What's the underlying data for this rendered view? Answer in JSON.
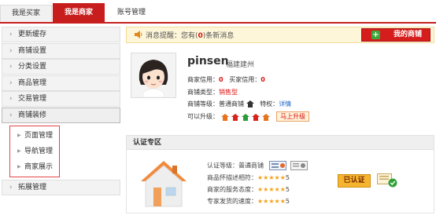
{
  "tabs": [
    {
      "label": "我是买家",
      "active": false
    },
    {
      "label": "我是商家",
      "active": true
    },
    {
      "label": "账号管理",
      "active": false
    }
  ],
  "sidebar": {
    "items": [
      {
        "label": "更新缓存"
      },
      {
        "label": "商铺设置"
      },
      {
        "label": "分类设置"
      },
      {
        "label": "商品管理"
      },
      {
        "label": "交易管理"
      },
      {
        "label": "商铺装修"
      }
    ],
    "submenu": [
      {
        "label": "页面管理"
      },
      {
        "label": "导航管理"
      },
      {
        "label": "商家展示"
      }
    ],
    "last_item": {
      "label": "拓展管理"
    }
  },
  "notice": {
    "prefix": "消息提醒：您有(",
    "count": "0",
    "suffix": ")条新消息"
  },
  "myshop_button": {
    "label": "我的商铺"
  },
  "profile": {
    "name": "pinsen",
    "location": "福建建州",
    "seller_credit_label": "商家信用：",
    "seller_credit": "0",
    "buyer_credit_label": "买家信用：",
    "buyer_credit": "0",
    "shop_type_label": "商铺类型：",
    "shop_type": "销售型",
    "shop_level_label": "商铺等级：",
    "shop_level": "普通商铺",
    "privilege_label": "特权：",
    "privilege_link": "详情",
    "upgrade_label": "可以升级：",
    "upgrade_button": "马上升级"
  },
  "cert": {
    "title": "认证专区",
    "level_label": "认证等级：",
    "level_value": "普通商铺",
    "rows": [
      {
        "label": "商品怀描述相符：",
        "stars": "★★★★★",
        "score": "5"
      },
      {
        "label": "商家的服务态度：",
        "stars": "★★★★★",
        "score": "5"
      },
      {
        "label": "专家发货的速度：",
        "stars": "★★★★★",
        "score": "5"
      }
    ],
    "verified_button": "已认证"
  },
  "colors": {
    "brand_red": "#c71d1d",
    "star": "#f3a21b",
    "link_blue": "#1a66c9"
  }
}
